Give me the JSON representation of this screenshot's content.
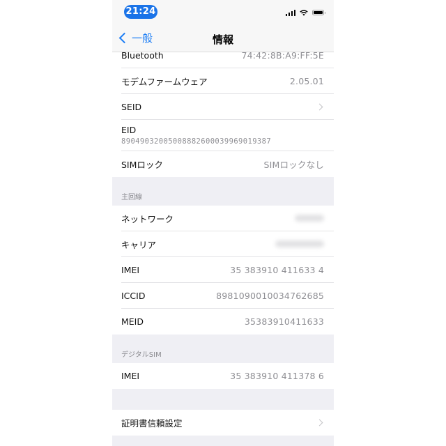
{
  "status_bar": {
    "time": "21:24",
    "icons": [
      "cellular-signal-icon",
      "wifi-icon",
      "battery-icon"
    ]
  },
  "nav": {
    "back_label": "一般",
    "title": "情報"
  },
  "groups": [
    {
      "header": null,
      "rows": [
        {
          "label": "Bluetooth",
          "value": "74:42:8B:A9:FF:5E"
        },
        {
          "label": "モデムファームウェア",
          "value": "2.05.01"
        },
        {
          "label": "SEID",
          "value": null,
          "chevron": true
        },
        {
          "label": "EID",
          "value": "89049032005008882600039969019387",
          "stacked": true
        },
        {
          "label": "SIMロック",
          "value": "SIMロックなし"
        }
      ]
    },
    {
      "header": "主回線",
      "rows": [
        {
          "label": "ネットワーク",
          "value": null,
          "redacted": true
        },
        {
          "label": "キャリア",
          "value": null,
          "redacted": true
        },
        {
          "label": "IMEI",
          "value": "35 383910 411633 4"
        },
        {
          "label": "ICCID",
          "value": "8981090010034762685"
        },
        {
          "label": "MEID",
          "value": "35383910411633"
        }
      ]
    },
    {
      "header": "デジタルSIM",
      "rows": [
        {
          "label": "IMEI",
          "value": "35 383910 411378 6"
        }
      ]
    },
    {
      "header": "",
      "rows": [
        {
          "label": "証明書信頼設定",
          "value": null,
          "chevron": true
        }
      ]
    }
  ],
  "colors": {
    "accent": "#1a7cf5",
    "time_pill": "#1a73e8",
    "grouped_background": "#efeff4",
    "secondary_text": "#8e8e93"
  }
}
